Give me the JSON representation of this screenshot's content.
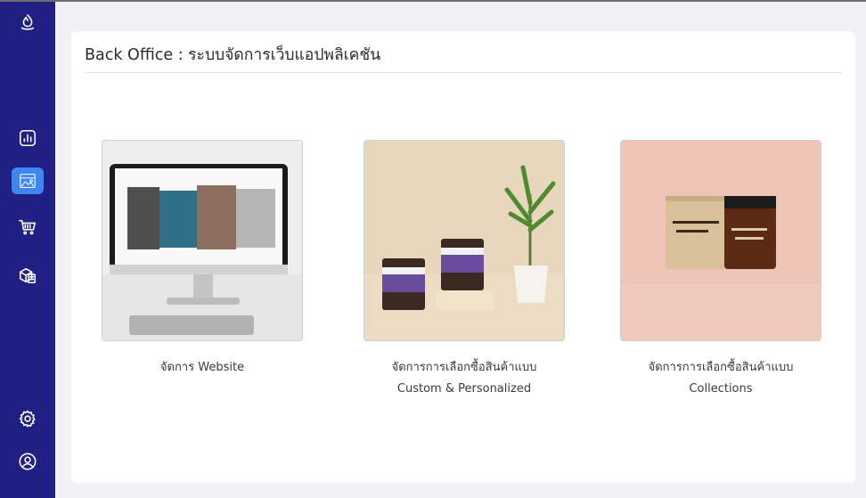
{
  "app": {
    "title": "Back Office : ระบบจัดการเว็บแอปพลิเคชัน"
  },
  "colors": {
    "sidebar_bg": "#1f1f84",
    "sidebar_active": "#3f86f2",
    "page_bg": "#f2f2f4",
    "panel_bg": "#ffffff"
  },
  "sidebar": {
    "logo_icon": "flame-logo-icon",
    "items": [
      {
        "icon": "bar-chart-icon",
        "active": false
      },
      {
        "icon": "image-gallery-icon",
        "active": true
      },
      {
        "icon": "shopping-cart-icon",
        "active": false
      },
      {
        "icon": "box-with-document-icon",
        "active": false
      }
    ],
    "bottom_items": [
      {
        "icon": "gear-icon"
      },
      {
        "icon": "user-circle-icon"
      }
    ]
  },
  "cards": [
    {
      "image": "desktop-computer-photo",
      "line1": "จัดการ Website",
      "line2": ""
    },
    {
      "image": "candle-jars-with-plant-photo",
      "line1": "จัดการการเลือกซื้อสินค้าแบบ",
      "line2": "Custom & Personalized"
    },
    {
      "image": "candle-box-and-jar-photo",
      "line1": "จัดการการเลือกซื้อสินค้าแบบ",
      "line2": "Collections"
    }
  ]
}
